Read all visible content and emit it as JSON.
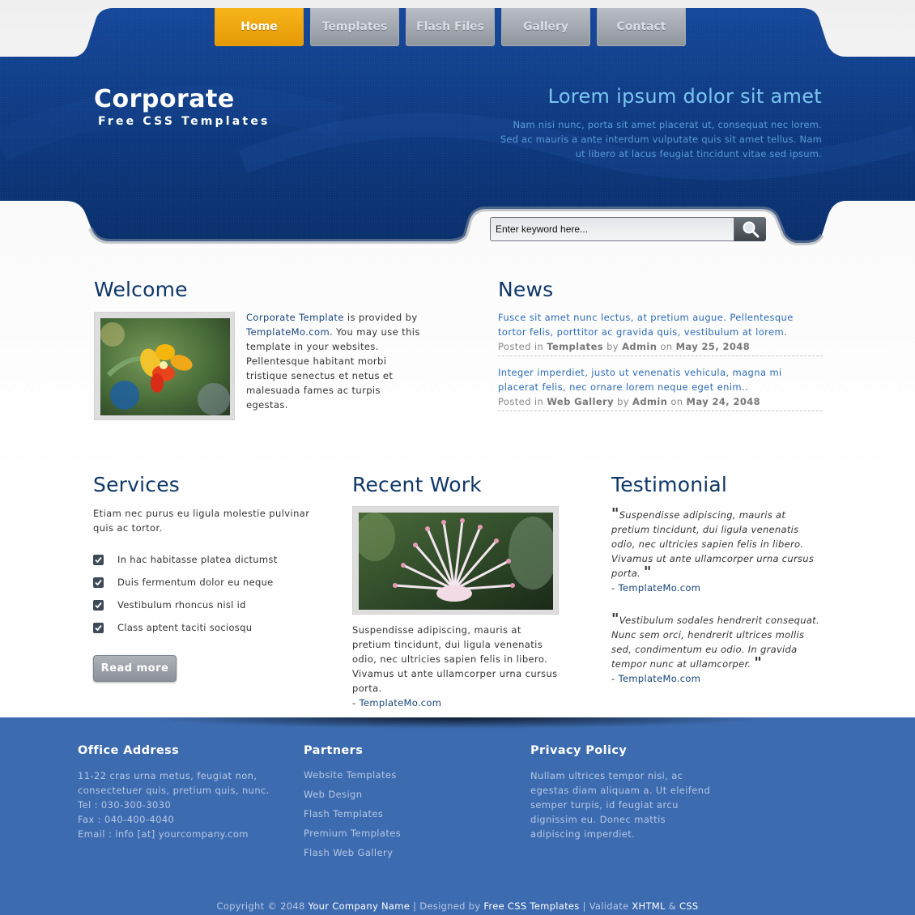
{
  "nav": [
    {
      "label": "Home",
      "active": true
    },
    {
      "label": "Templates",
      "active": false
    },
    {
      "label": "Flash Files",
      "active": false
    },
    {
      "label": "Gallery",
      "active": false
    },
    {
      "label": "Contact",
      "active": false
    }
  ],
  "logo": {
    "title": "Corporate",
    "subtitle": "Free CSS Templates"
  },
  "tagline": {
    "title": "Lorem ipsum dolor sit amet",
    "line1": "Nam nisi nunc, porta sit amet placerat ut, consequat nec lorem.",
    "line2": "Sed ac mauris a ante interdum vulputate quis sit amet tellus. Nam",
    "line3": "ut libero at lacus feugiat tincidunt vitae sed ipsum."
  },
  "search": {
    "placeholder": "Enter keyword here..."
  },
  "welcome": {
    "title": "Welcome",
    "link1": "Corporate Template",
    "t1": " is provided by ",
    "link2": "TemplateMo.com",
    "t2": ". You may use this template in your websites. Pellentesque habitant morbi tristique senectus et netus et malesuada fames ac turpis egestas."
  },
  "news": {
    "title": "News",
    "items": [
      {
        "text": "Fusce sit amet nunc lectus, at pretium augue. Pellentesque tortor felis, porttitor ac gravida quis, vestibulum at lorem.",
        "posted": "Posted in",
        "category": "Templates",
        "by": "by",
        "author": "Admin",
        "on": "on",
        "date": "May 25, 2048"
      },
      {
        "text": "Integer imperdiet, justo ut venenatis vehicula, magna mi placerat felis, nec ornare lorem neque eget enim..",
        "posted": "Posted in",
        "category": "Web Gallery",
        "by": "by",
        "author": "Admin",
        "on": "on",
        "date": "May 24, 2048"
      }
    ]
  },
  "services": {
    "title": "Services",
    "intro": "Etiam nec purus eu ligula molestie pulvinar quis ac tortor.",
    "items": [
      "In hac habitasse platea dictumst",
      "Duis fermentum dolor eu neque",
      "Vestibulum rhoncus nisl id",
      "Class aptent taciti sociosqu"
    ],
    "button": "Read more"
  },
  "recent": {
    "title": "Recent Work",
    "text": "Suspendisse adipiscing, mauris at pretium tincidunt, dui ligula venenatis odio, nec ultricies sapien felis in libero. Vivamus ut ante ullamcorper urna cursus porta.",
    "dash": "- ",
    "link": "TemplateMo.com"
  },
  "testimonial": {
    "title": "Testimonial",
    "items": [
      {
        "quote": "Suspendisse adipiscing, mauris at pretium tincidunt, dui ligula venenatis odio, nec ultricies sapien felis in libero. Vivamus ut ante ullamcorper urna cursus porta.",
        "dash": "- ",
        "source": "TemplateMo.com"
      },
      {
        "quote": "Vestibulum sodales hendrerit consequat. Nunc sem orci, hendrerit ultrices mollis sed, condimentum eu odio. In gravida tempor nunc at ullamcorper.",
        "dash": "- ",
        "source": "TemplateMo.com"
      }
    ]
  },
  "footer": {
    "office": {
      "title": "Office Address",
      "l1": "11-22 cras urna metus, feugiat non,",
      "l2": "consectetuer quis, pretium quis, nunc.",
      "l3": "Tel : 030-300-3030",
      "l4": "Fax : 040-400-4040",
      "l5": "Email : info [at] yourcompany.com"
    },
    "partners": {
      "title": "Partners",
      "links": [
        "Website Templates",
        "Web Design",
        "Flash Templates",
        "Premium Templates",
        "Flash Web Gallery"
      ]
    },
    "privacy": {
      "title": "Privacy Policy",
      "text": "Nullam ultrices tempor nisi, ac egestas diam aliquam a. Ut eleifend semper turpis, id feugiat arcu dignissim eu. Donec mattis adipiscing imperdiet."
    },
    "copyright": {
      "c1": "Copyright © 2048 ",
      "company": "Your Company Name",
      "c2": " | Designed by ",
      "designer": "Free CSS Templates",
      "c3": " | Validate ",
      "xhtml": "XHTML",
      "amp": " & ",
      "css": "CSS"
    }
  },
  "colors": {
    "header_blue": "#0f3e86",
    "accent_orange": "#f3a80f",
    "footer_blue": "#3d6baf",
    "heading": "#0f3768"
  }
}
